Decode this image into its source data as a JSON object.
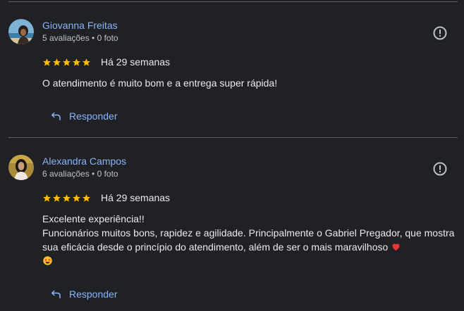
{
  "reviews": [
    {
      "author": "Giovanna Freitas",
      "meta": "5 avaliações • 0 foto",
      "rating": 5,
      "date": "Há 29 semanas",
      "text_lines": [
        "O atendimento é muito bom e a entrega super rápida!"
      ],
      "reply_label": "Responder"
    },
    {
      "author": "Alexandra Campos",
      "meta": "6 avaliações • 0 foto",
      "rating": 5,
      "date": "Há 29 semanas",
      "text_lines": [
        "Excelente experiência!!",
        "Funcionários muitos bons, rapidez e agilidade. Principalmente o Gabriel Pregador, que mostra sua eficácia desde o princípio do atendimento, além de ser o mais maravilhoso"
      ],
      "emojis": [
        "red-heart",
        "star-struck"
      ],
      "reply_label": "Responder"
    }
  ],
  "colors": {
    "background": "#202124",
    "link": "#8ab4f8",
    "star": "#fbbc04",
    "muted": "#bdc1c6",
    "divider": "#5f6368"
  }
}
